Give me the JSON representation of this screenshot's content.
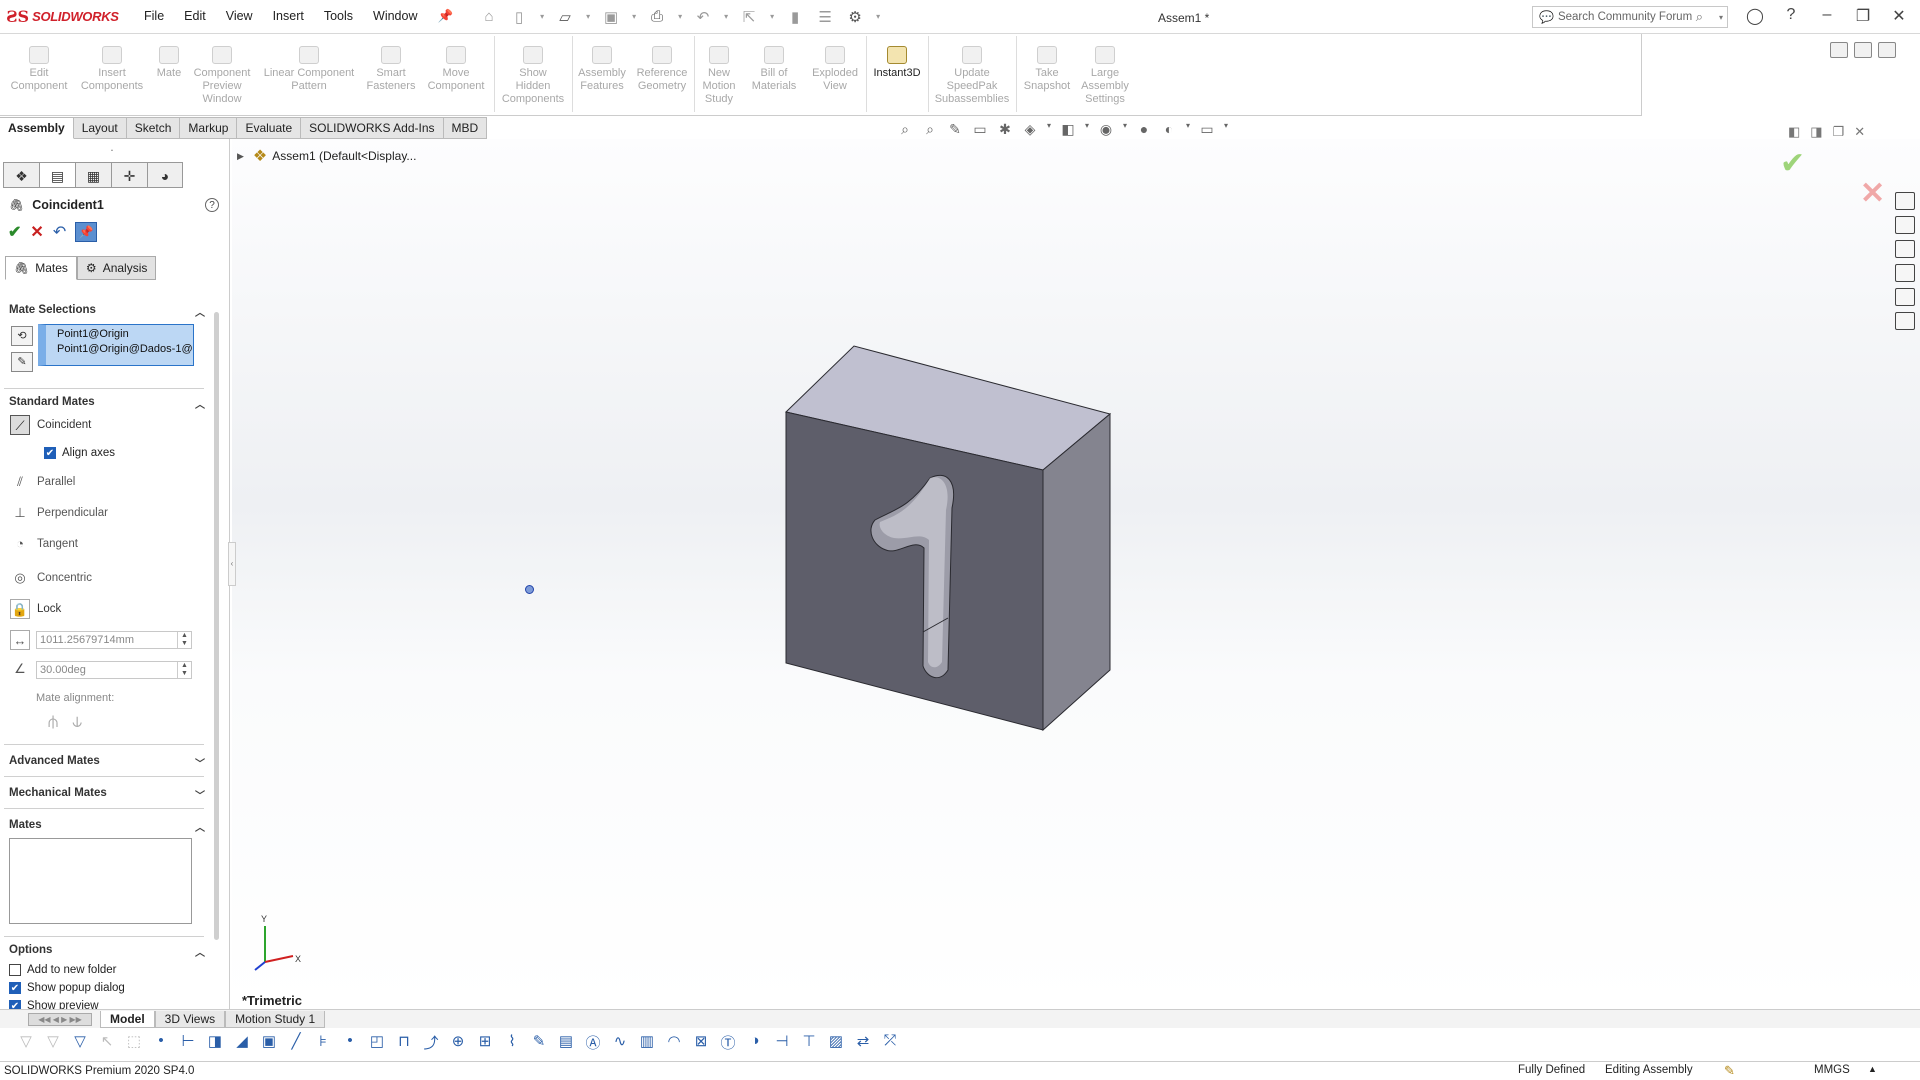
{
  "app": {
    "logo_text": "SOLIDWORKS",
    "doc_title": "Assem1 *"
  },
  "menu": [
    "File",
    "Edit",
    "View",
    "Insert",
    "Tools",
    "Window"
  ],
  "search": {
    "placeholder": "Search Community Forum"
  },
  "ribbon": {
    "buttons": [
      {
        "label": "Edit\nComponent",
        "enabled": false
      },
      {
        "label": "Insert\nComponents",
        "enabled": false
      },
      {
        "label": "Mate",
        "enabled": false
      },
      {
        "label": "Component\nPreview\nWindow",
        "enabled": false
      },
      {
        "label": "Linear Component\nPattern",
        "enabled": false
      },
      {
        "label": "Smart\nFasteners",
        "enabled": false
      },
      {
        "label": "Move\nComponent",
        "enabled": false
      },
      {
        "label": "Show\nHidden\nComponents",
        "enabled": false
      },
      {
        "label": "Assembly\nFeatures",
        "enabled": false
      },
      {
        "label": "Reference\nGeometry",
        "enabled": false
      },
      {
        "label": "New\nMotion\nStudy",
        "enabled": false
      },
      {
        "label": "Bill of\nMaterials",
        "enabled": false
      },
      {
        "label": "Exploded\nView",
        "enabled": false
      },
      {
        "label": "Instant3D",
        "enabled": true
      },
      {
        "label": "Update\nSpeedPak\nSubassemblies",
        "enabled": false
      },
      {
        "label": "Take\nSnapshot",
        "enabled": false
      },
      {
        "label": "Large\nAssembly\nSettings",
        "enabled": false
      }
    ]
  },
  "tabs": [
    "Assembly",
    "Layout",
    "Sketch",
    "Markup",
    "Evaluate",
    "SOLIDWORKS Add-Ins",
    "MBD"
  ],
  "feature_tree": {
    "root_label": "Assem1  (Default<Display..."
  },
  "property_manager": {
    "title": "Coincident1",
    "subtabs": [
      "Mates",
      "Analysis"
    ],
    "mate_selections": {
      "header": "Mate Selections",
      "items": [
        "Point1@Origin",
        "Point1@Origin@Dados-1@"
      ]
    },
    "standard_mates": {
      "header": "Standard Mates",
      "coincident": "Coincident",
      "align_axes": "Align axes",
      "parallel": "Parallel",
      "perpendicular": "Perpendicular",
      "tangent": "Tangent",
      "concentric": "Concentric",
      "lock": "Lock",
      "distance_value": "1011.25679714mm",
      "angle_value": "30.00deg",
      "mate_alignment_label": "Mate alignment:"
    },
    "advanced_mates": "Advanced Mates",
    "mechanical_mates": "Mechanical Mates",
    "mates_header": "Mates",
    "options": {
      "header": "Options",
      "add_to_new_folder": "Add to new folder",
      "show_popup_dialog": "Show popup dialog",
      "show_preview": "Show preview"
    }
  },
  "viewport": {
    "view_name": "*Trimetric",
    "part_digit": "1",
    "triad_x": "X",
    "triad_y": "Y"
  },
  "bottom_tabs": [
    "Model",
    "3D Views",
    "Motion Study 1"
  ],
  "status": {
    "product": "SOLIDWORKS Premium 2020 SP4.0",
    "state": "Fully Defined",
    "mode": "Editing Assembly",
    "units": "MMGS"
  }
}
